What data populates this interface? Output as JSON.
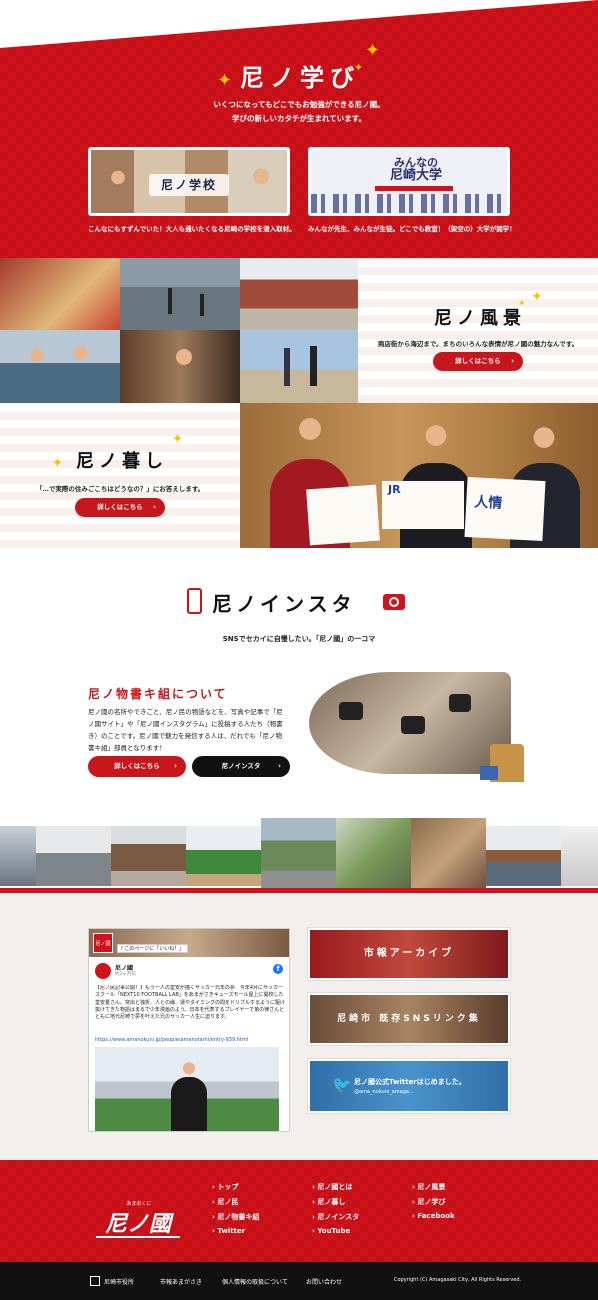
{
  "manabi": {
    "title": "尼ノ学び",
    "lead1": "いくつになってもどこでもお勉強ができる尼ノ國。",
    "lead2": "学びの新しいカタチが生まれています。",
    "card1_title": "尼ノ学校",
    "card1_caption": "こんなにもすずんでいた！大人も通いたくなる尼崎の学校を潜入取材。",
    "card2_title_a": "みんなの",
    "card2_title_b": "尼崎大学",
    "card2_caption": "みんなが先生、みんなが生徒。どこでも教室！（架空の）大学が開学！"
  },
  "fukei": {
    "title": "尼ノ風景",
    "desc": "商店街から海辺まで。まちのいろんな表情が尼ノ國の魅力なんです。",
    "button": "詳しくはこちら"
  },
  "kurashi": {
    "title": "尼ノ暮し",
    "desc": "「…で実際の住みごこちはどうなの？」にお答えします。",
    "button": "詳しくはこちら",
    "sign1": "JR",
    "sign2": "人情"
  },
  "insta": {
    "title": "尼ノインスタ",
    "subtitle": "SNSでセカイに自慢したい。「尼ノ國」の一コマ",
    "club_title": "尼ノ物書キ組について",
    "para": "尼ノ國の名所やできごと、尼ノ民の物語などを、写真や記事で「尼ノ國サイト」や「尼ノ國インスタグラム」に投稿する人たち（物書き）のことです。尼ノ國で魅力を発信する人は、だれでも「尼ノ物書キ組」部員となります！",
    "button1": "詳しくはこちら",
    "button2": "尼ノインスタ"
  },
  "widgets": {
    "fb_page_name": "尼ノ國",
    "fb_like": "このページに「いいね！」",
    "fb_date": "約2ヶ月前",
    "fb_post": "【尼ノ民記事公開！】もう一人の堂安が描くサッカー元年の夢　今年4月にサッカースクール「NEXT10 FOOTBALL LAB」をあまがさきキューズモール屋上に開校した堂安憂さん。突出と独折、人との縁、運やタイミングの問をドリブルするように駆け抜けてきた物語はまるで少年漫画のよう。日本を代表するプレイヤーで弟の律さんとともに地元尼崎で夢を叶えた兄のサッカー人生に迫ります。",
    "fb_link": "https://www.amanokuni.jp/people/amanotami/entry-939.html",
    "banner1": "市報アーカイブ",
    "banner2": "尼崎市 既存SNSリンク集",
    "banner3_title": "尼ノ國公式Twitterはじめました。",
    "banner3_handle": "@ama_nokuni_amaga..."
  },
  "footer": {
    "logo_small": "あまのくに",
    "logo": "尼ノ國",
    "col1": [
      "トップ",
      "尼ノ民",
      "尼ノ物書キ組",
      "Twitter"
    ],
    "col2": [
      "尼ノ國とは",
      "尼ノ暮し",
      "尼ノインスタ",
      "YouTube"
    ],
    "col3": [
      "尼ノ風景",
      "尼ノ学び",
      "Facebook"
    ]
  },
  "bottom": {
    "city": "尼崎市役所",
    "link1": "市報あまがさき",
    "link2": "個人情報の取扱について",
    "link3": "お問い合わせ",
    "copyright": "Copyright (C) Amagasaki City, All Rights Reserved."
  },
  "colors": {
    "brand_red": "#d0121b",
    "dark": "#111111",
    "gold": "#f5c400",
    "twitter_blue": "#3a8ac8"
  }
}
